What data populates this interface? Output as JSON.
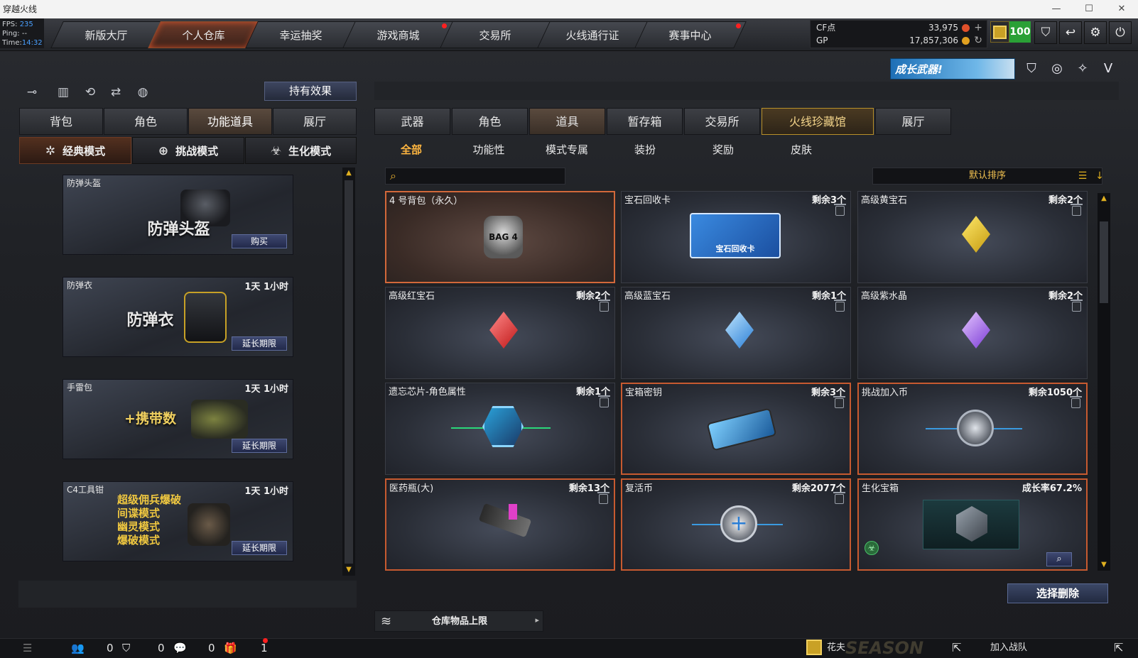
{
  "window": {
    "title": "穿越火线",
    "minimize": "—",
    "maximize": "☐",
    "close": "✕"
  },
  "perf": {
    "fps_label": "FPS:",
    "fps": "235",
    "ping_label": "Ping:",
    "ping": "--",
    "time_label": "Time:",
    "time": "14:32"
  },
  "nav": {
    "tabs": [
      "新版大厅",
      "个人仓库",
      "幸运抽奖",
      "游戏商城",
      "交易所",
      "火线通行证",
      "赛事中心"
    ],
    "active": 1
  },
  "currency": {
    "cf_label": "CF点",
    "cf_value": "33,975",
    "gp_label": "GP",
    "gp_value": "17,857,306",
    "level": "100"
  },
  "promo": {
    "text": "成长武器!"
  },
  "left": {
    "effect_button": "持有效果",
    "tabs": [
      "背包",
      "角色",
      "功能道具",
      "展厅"
    ],
    "active_tab": 2,
    "modes": [
      "经典模式",
      "挑战模式",
      "生化模式"
    ],
    "active_mode": 0,
    "items": [
      {
        "name": "防弹头盔",
        "time": "",
        "art_text": "防弹头盔",
        "action": "购买"
      },
      {
        "name": "防弹衣",
        "time": "1天 1小时",
        "art_text": "防弹衣",
        "action": "延长期限"
      },
      {
        "name": "手雷包",
        "time": "1天 1小时",
        "art_text": "+携带数",
        "action": "延长期限"
      },
      {
        "name": "C4工具钳",
        "time": "1天 1小时",
        "art_lines": [
          "超级佣兵爆破",
          "间谍模式",
          "幽灵模式",
          "爆破模式"
        ],
        "action": "延长期限"
      }
    ]
  },
  "right": {
    "tabs": [
      "武器",
      "角色",
      "道具",
      "暂存箱",
      "交易所",
      "火线珍藏馆",
      "展厅"
    ],
    "active_tab": 2,
    "subtabs": [
      "全部",
      "功能性",
      "模式专属",
      "装扮",
      "奖励",
      "皮肤"
    ],
    "active_subtab": 0,
    "search_placeholder": "",
    "sort_label": "默认排序",
    "items": [
      {
        "name": "4 号背包（永久）",
        "count": ""
      },
      {
        "name": "宝石回收卡",
        "count": "剩余3个"
      },
      {
        "name": "高级黄宝石",
        "count": "剩余2个"
      },
      {
        "name": "高级红宝石",
        "count": "剩余2个"
      },
      {
        "name": "高级蓝宝石",
        "count": "剩余1个"
      },
      {
        "name": "高级紫水晶",
        "count": "剩余2个"
      },
      {
        "name": "遗忘芯片-角色属性",
        "count": "剩余1个"
      },
      {
        "name": "宝箱密钥",
        "count": "剩余3个"
      },
      {
        "name": "挑战加入币",
        "count": "剩余1050个"
      },
      {
        "name": "医药瓶(大)",
        "count": "剩余13个"
      },
      {
        "name": "复活币",
        "count": "剩余2077个"
      },
      {
        "name": "生化宝箱",
        "count": "成长率67.2%"
      }
    ],
    "recycle_card_text": "宝石回收卡",
    "bag_text": "BAG 4",
    "delete_button": "选择删除",
    "storage_label": "仓库物品上限"
  },
  "bottom": {
    "friends": "0",
    "clan": "0",
    "chat": "0",
    "gifts": "1",
    "user": "花夫",
    "season": "SEASON 27",
    "join": "加入战队"
  },
  "colors": {
    "accent": "#ffb640",
    "alert": "#ff2020",
    "highlight": "#c75a30"
  }
}
